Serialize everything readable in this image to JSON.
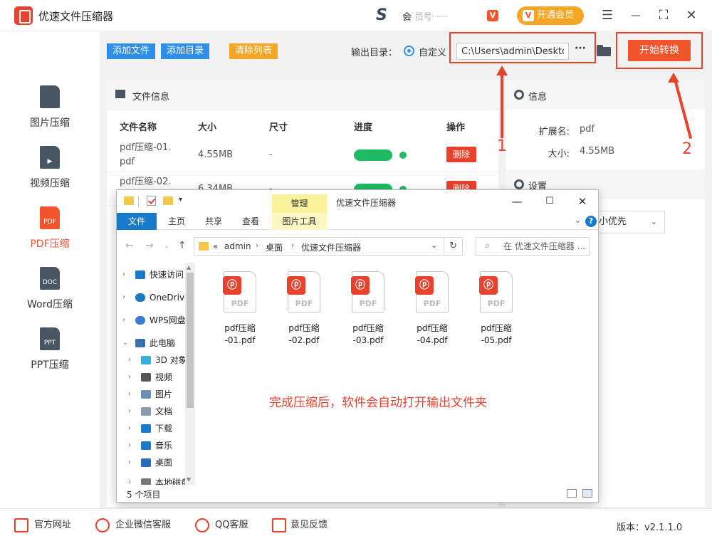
{
  "window": {
    "title": "优速文件压缩器",
    "member_text": "会",
    "member_blur": "员号·  ·····",
    "vip_button": "开通会员",
    "controls": {
      "menu": "☰",
      "minimize": "—",
      "maximize": "⛶",
      "close": "✕"
    }
  },
  "sidebar": {
    "items": [
      {
        "label": "图片压缩",
        "icon": "image-file-icon",
        "glyph": ""
      },
      {
        "label": "视频压缩",
        "icon": "video-file-icon",
        "glyph": "▶"
      },
      {
        "label": "PDF压缩",
        "icon": "pdf-file-icon",
        "glyph": "PDF",
        "active": true
      },
      {
        "label": "Word压缩",
        "icon": "doc-file-icon",
        "glyph": "DOC"
      },
      {
        "label": "PPT压缩",
        "icon": "ppt-file-icon",
        "glyph": "PPT"
      }
    ]
  },
  "toolbar": {
    "add_file": "添加文件",
    "add_dir": "添加目录",
    "clear_list": "清除列表",
    "output_label": "输出目录：",
    "radio_label": "自定义",
    "output_path": "C:\\Users\\admin\\Desktop",
    "more": "···",
    "start": "开始转换"
  },
  "file_panel": {
    "title": "文件信息",
    "columns": [
      "文件名称",
      "大小",
      "尺寸",
      "进度",
      "操作"
    ],
    "rows": [
      {
        "name1": "pdf压缩-01.",
        "name2": "pdf",
        "size": "4.55MB",
        "dim": "-",
        "progress": 1.0,
        "action": "删除"
      },
      {
        "name1": "pdf压缩-02.",
        "name2": "pdf",
        "size": "6.34MB",
        "dim": "-",
        "progress": 1.0,
        "action": "删除"
      }
    ]
  },
  "info_panel": {
    "title": "信息",
    "ext_label": "扩展名:",
    "ext_value": "pdf",
    "size_label": "大小:",
    "size_value": "4.55MB",
    "settings_title": "设置",
    "priority": "小优先"
  },
  "annotations": {
    "one": "1",
    "two": "2",
    "color": "#e8412c"
  },
  "explorer": {
    "manage_tab": "管理",
    "window_title": "优速文件压缩器",
    "ribbon_tabs": [
      "文件",
      "主页",
      "共享",
      "查看"
    ],
    "picture_tools": "图片工具",
    "path": {
      "root": "«",
      "parts": [
        "admin",
        "桌面",
        "优速文件压缩器"
      ]
    },
    "search_placeholder": "在 优速文件压缩器 ...",
    "tree": [
      {
        "label": "快速访问",
        "icon": "quick-access-icon",
        "color": "#1979ca"
      },
      {
        "label": "OneDrive",
        "icon": "onedrive-icon",
        "color": "#1979ca"
      },
      {
        "label": "WPS网盘",
        "icon": "wps-cloud-icon",
        "color": "#3a7bd5"
      },
      {
        "label": "此电脑",
        "icon": "this-pc-icon",
        "color": "#3a6fb0"
      },
      {
        "label": "3D 对象",
        "icon": "3d-objects-icon",
        "color": "#3ab0d6"
      },
      {
        "label": "视频",
        "icon": "videos-folder-icon",
        "color": "#555"
      },
      {
        "label": "图片",
        "icon": "pictures-folder-icon",
        "color": "#6a8fb3"
      },
      {
        "label": "文档",
        "icon": "documents-folder-icon",
        "color": "#8a9bb0"
      },
      {
        "label": "下载",
        "icon": "downloads-folder-icon",
        "color": "#1979ca"
      },
      {
        "label": "音乐",
        "icon": "music-folder-icon",
        "color": "#1979ca"
      },
      {
        "label": "桌面",
        "icon": "desktop-folder-icon",
        "color": "#2a6cb8"
      },
      {
        "label": "本地磁盘",
        "icon": "local-disk-icon",
        "color": "#777"
      }
    ],
    "files": [
      {
        "line1": "pdf压缩",
        "line2": "-01.pdf"
      },
      {
        "line1": "pdf压缩",
        "line2": "-02.pdf"
      },
      {
        "line1": "pdf压缩",
        "line2": "-03.pdf"
      },
      {
        "line1": "pdf压缩",
        "line2": "-04.pdf"
      },
      {
        "line1": "pdf压缩",
        "line2": "-05.pdf"
      }
    ],
    "file_type_text": "PDF",
    "message": "完成压缩后，软件会自动打开输出文件夹",
    "status": "5 个项目"
  },
  "footer": {
    "items": [
      "官方网址",
      "企业微信客服",
      "QQ客服",
      "意见反馈"
    ],
    "version": "版本：v2.1.1.0"
  }
}
